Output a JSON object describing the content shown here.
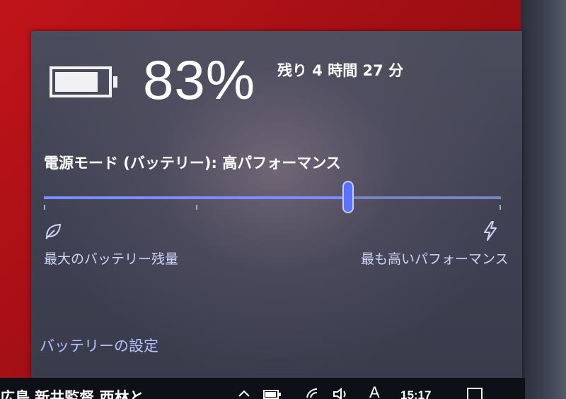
{
  "battery": {
    "percent_text": "83%",
    "percent_value": 83,
    "remaining": "残り 4 時間 27 分"
  },
  "power_mode": {
    "label": "電源モード (バッテリー): 高パフォーマンス",
    "slider_position": 0.665,
    "min_label": "最大のバッテリー残量",
    "max_label": "最も高いパフォーマンス",
    "min_icon": "leaf-icon",
    "max_icon": "lightning-bolt-icon"
  },
  "settings_link": "バッテリーの設定",
  "taskbar": {
    "news": "広島 新井監督 西林と",
    "clock": "15:17",
    "tray_icons": [
      "chevron-up-icon",
      "battery-icon",
      "wifi-icon",
      "speaker-icon",
      "ime-icon",
      "notification-icon"
    ],
    "ime_label": "A"
  },
  "colors": {
    "accent": "#5a72ff",
    "link": "#b4c2ff",
    "desktop": "#c0141a"
  }
}
